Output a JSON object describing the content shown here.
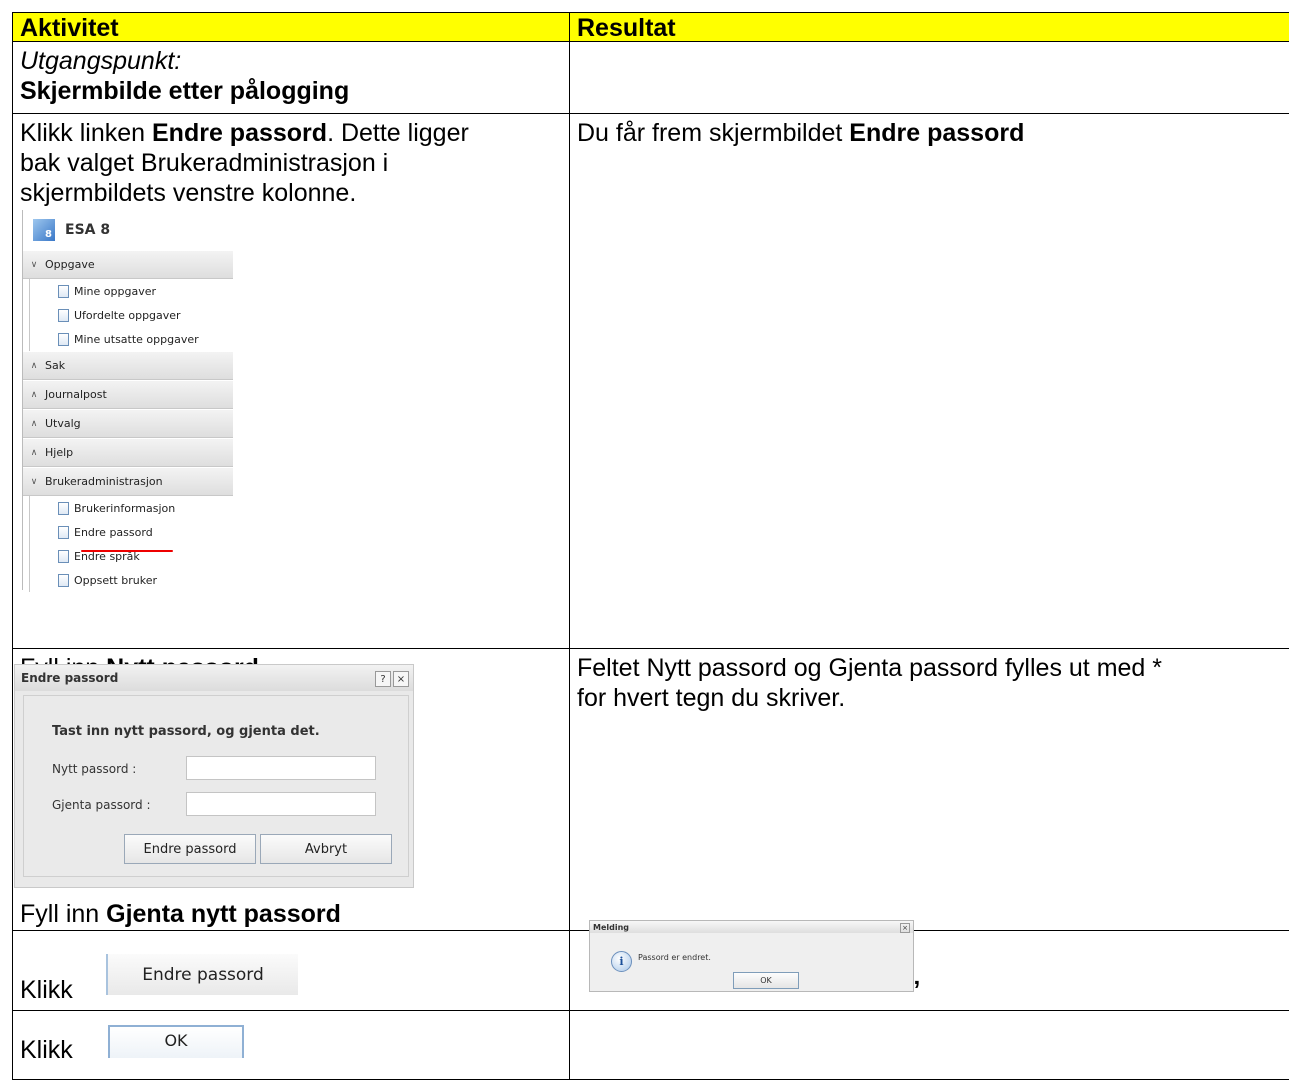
{
  "header": {
    "col1": "Aktivitet",
    "col2": "Resultat"
  },
  "row1": {
    "italic": "Utgangspunkt:",
    "bold": "Skjermbilde etter pålogging"
  },
  "row2": {
    "l1_pre": "Klikk linken ",
    "l1_bold": "Endre passord",
    "l1_post": ". Dette ligger",
    "l2": "bak valget Brukeradministrasjon i",
    "l3": "skjermbildets venstre kolonne.",
    "result_pre": "Du får frem skjermbildet ",
    "result_bold": "Endre passord",
    "sidebar": {
      "logo_digit": "8",
      "brand": "ESA 8",
      "sections": [
        {
          "label": "Oppgave",
          "items": [
            "Mine oppgaver",
            "Ufordelte oppgaver",
            "Mine utsatte oppgaver"
          ]
        },
        {
          "label": "Sak"
        },
        {
          "label": "Journalpost"
        },
        {
          "label": "Utvalg"
        },
        {
          "label": "Hjelp"
        },
        {
          "label": "Brukeradministrasjon",
          "items": [
            "Brukerinformasjon",
            "Endre passord",
            "Endre språk",
            "Oppsett bruker"
          ]
        }
      ]
    }
  },
  "row3": {
    "top_pre": "Fyll inn ",
    "top_bold": "Nytt passord",
    "bottom_pre": "Fyll inn ",
    "bottom_bold": "Gjenta nytt passord",
    "result_l1": "Feltet Nytt passord og Gjenta passord fylles ut med *",
    "result_l2": "for hvert tegn du skriver.",
    "dialog": {
      "title": "Endre passord",
      "help": "?",
      "close": "×",
      "instruction": "Tast inn nytt passord, og gjenta det.",
      "new_label": "Nytt passord :",
      "repeat_label": "Gjenta passord :",
      "submit": "Endre passord",
      "cancel": "Avbryt"
    }
  },
  "row4": {
    "klikk": "Klikk",
    "button_image": "Endre passord",
    "message": {
      "title": "Melding",
      "close": "×",
      "icon": "i",
      "text": "Passord er endret.",
      "ok": "OK"
    },
    "trailing": "„"
  },
  "row5": {
    "klikk": "Klikk",
    "button_image": "OK"
  }
}
